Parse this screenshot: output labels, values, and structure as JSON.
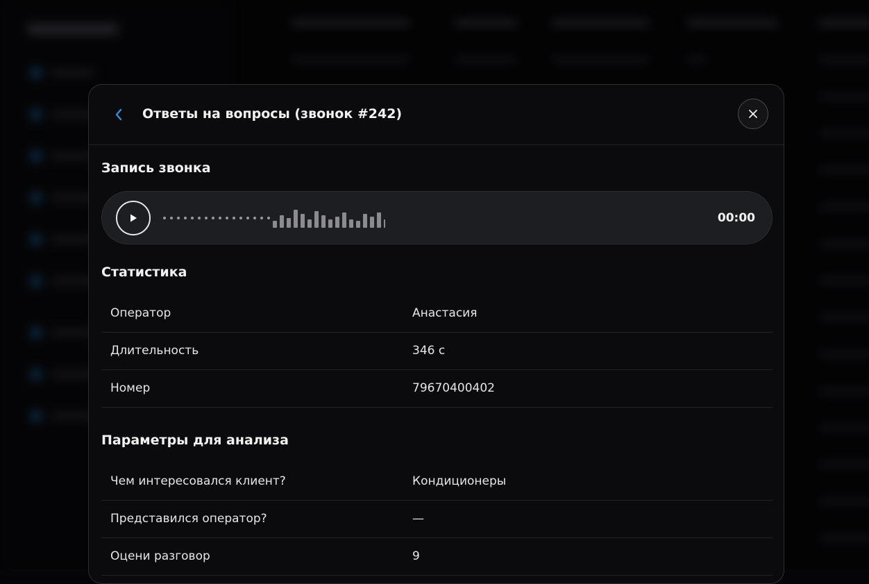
{
  "modal": {
    "title": "Ответы на вопросы (звонок #242)"
  },
  "recording": {
    "section_title": "Запись звонка",
    "time": "00:00"
  },
  "stats": {
    "section_title": "Статистика",
    "rows": [
      {
        "key": "Оператор",
        "value": "Анастасия"
      },
      {
        "key": "Длительность",
        "value": "346 с"
      },
      {
        "key": "Номер",
        "value": "79670400402"
      }
    ]
  },
  "analysis": {
    "section_title": "Параметры для анализа",
    "rows": [
      {
        "key": "Чем интересовался клиент?",
        "value": "Кондиционеры"
      },
      {
        "key": "Представился оператор?",
        "value": "—"
      },
      {
        "key": "Оцени разговор",
        "value": "9"
      }
    ]
  },
  "icons": {
    "back": "chevron-left-icon",
    "close": "close-icon",
    "play": "play-icon"
  },
  "colors": {
    "accent": "#2f8fe0",
    "modal_bg": "#0b0b0d",
    "player_bg": "#1d1e22"
  }
}
